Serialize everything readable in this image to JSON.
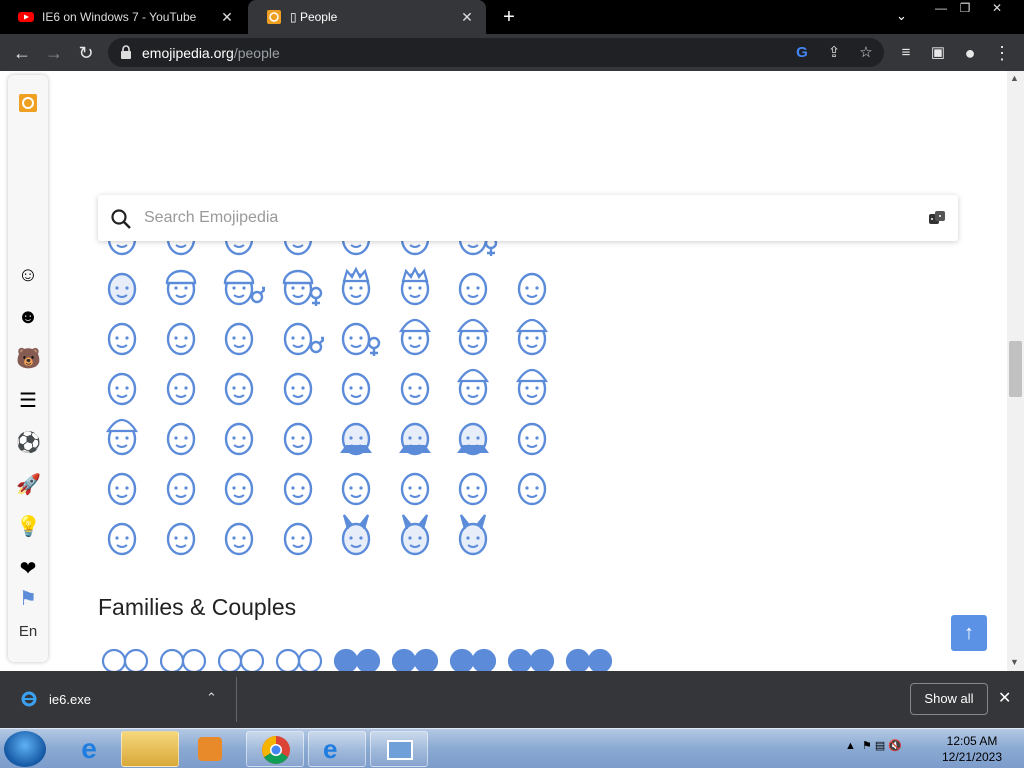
{
  "tabs": [
    {
      "title": "IE6 on Windows 7 - YouTube",
      "close": "✕"
    },
    {
      "title": "▯ People",
      "close": "✕"
    }
  ],
  "new_tab": "+",
  "window_controls": [
    "—",
    "❐",
    "✕"
  ],
  "address": {
    "host": "emojipedia.org",
    "path": "/people"
  },
  "search": {
    "placeholder": "Search Emojipedia"
  },
  "sidebar": {
    "language": "En"
  },
  "section": {
    "title": "Families & Couples"
  },
  "download": {
    "filename": "ie6.exe",
    "show_all": "Show all",
    "close": "✕"
  },
  "clock": {
    "time": "12:05 AM",
    "date": "12/21/2023"
  },
  "colors": {
    "emoji_blue": "#5b8bd9",
    "accent": "#5b92e5"
  },
  "emoji_grid": {
    "rows": [
      [
        "man",
        "woman-facepalm",
        "person-facepalm",
        "man-facepalm",
        "prince",
        "man-prince",
        "woman-prince"
      ],
      [
        "person-covering-mouth",
        "construction-worker",
        "construction-worker-male",
        "construction-worker-female",
        "crown-person",
        "crown-person-2",
        "person-curly",
        "ghost-bowtie"
      ],
      [
        "ghost-bowtie-2",
        "ghost-bowtie-3",
        "bride",
        "bride-male",
        "bride-female",
        "santa",
        "mrs-claus",
        "mx-claus"
      ],
      [
        "superhero",
        "superhero-2",
        "superhero-3",
        "supervillain",
        "supervillain-2",
        "supervillain-3",
        "mage",
        "mage-2"
      ],
      [
        "mage-3",
        "fairy",
        "fairy-2",
        "fairy-3",
        "vampire",
        "vampire-2",
        "vampire-3",
        "merperson"
      ],
      [
        "merman",
        "mermaid",
        "elf",
        "elf-2",
        "elf-3",
        "genie",
        "genie-2",
        "genie-3"
      ],
      [
        "zombie",
        "zombie-2",
        "zombie-3",
        "troll",
        "people-bunny-ears",
        "men-bunny-ears",
        "women-bunny-ears"
      ]
    ]
  }
}
